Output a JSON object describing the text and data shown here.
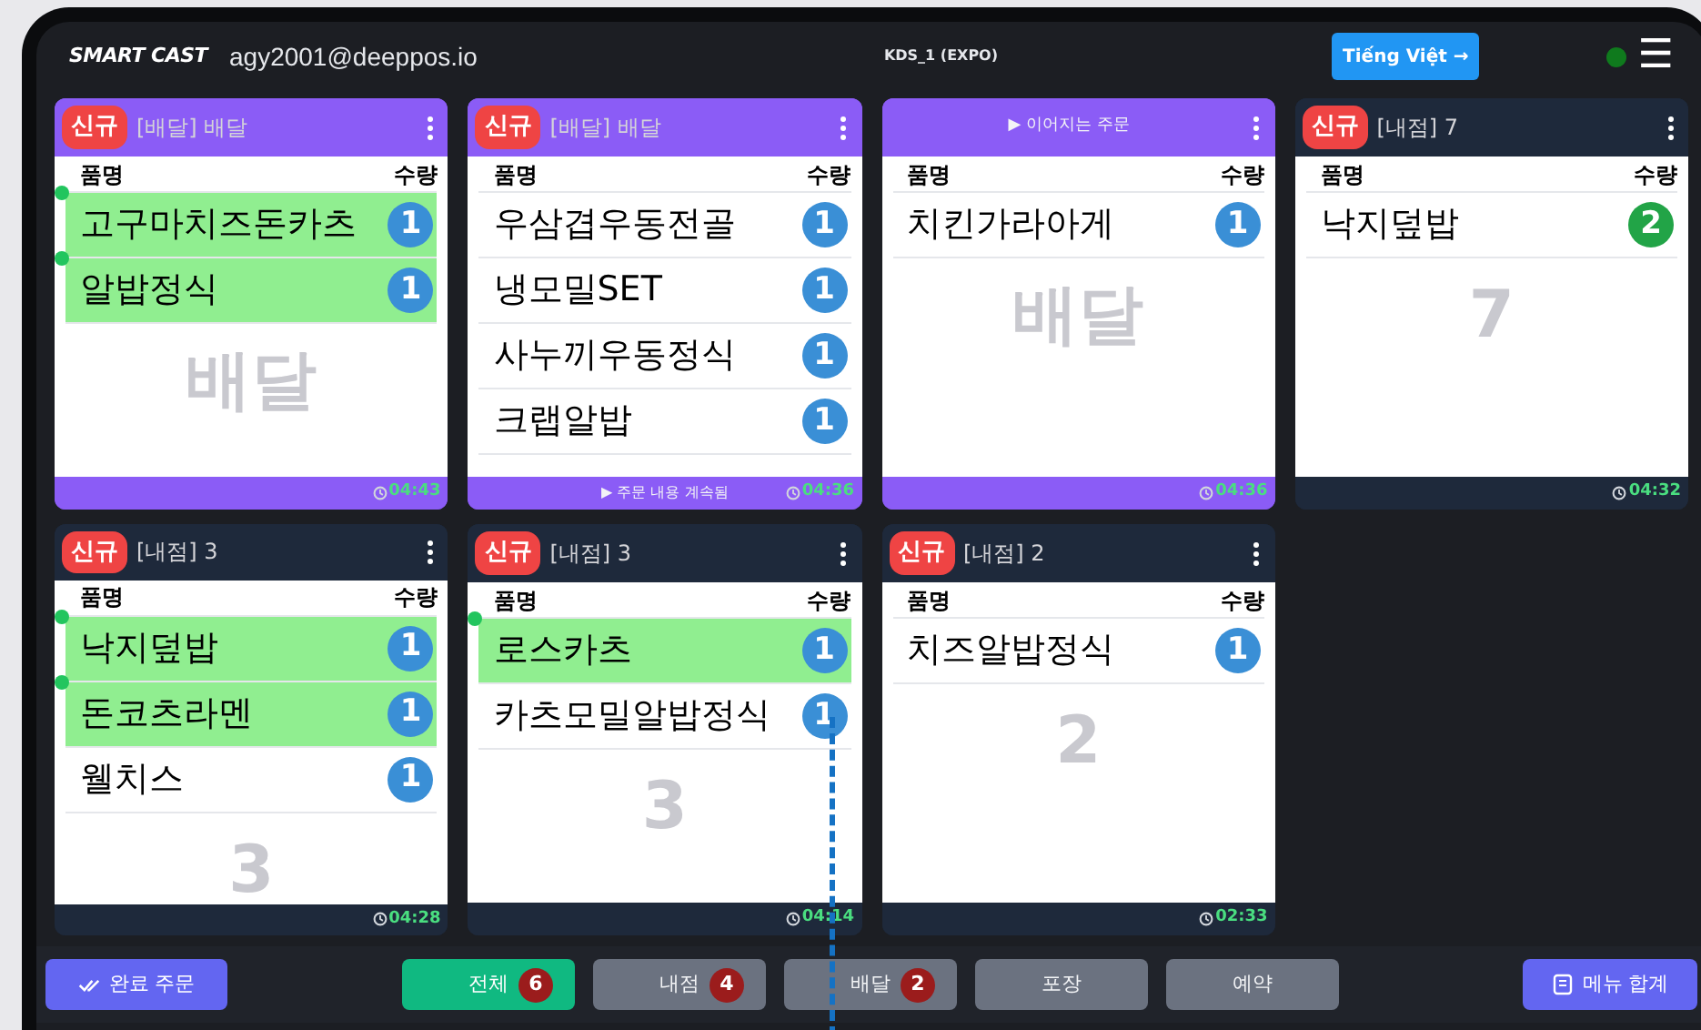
{
  "header": {
    "logo": "SMART CAST",
    "account": "agy2001@deeppos.io",
    "station": "KDS_1 (EXPO)",
    "language_button": "Tiếng Việt →",
    "menu_icon": "☰"
  },
  "orders": [
    {
      "kind": "delivery",
      "badge": "신규",
      "title": "[배달] 배달",
      "name_column": "품명",
      "qty_column": "수량",
      "watermark": "배달",
      "time": "04:43",
      "items": [
        {
          "name": "고구마치즈돈카츠",
          "qty": "1",
          "done": true
        },
        {
          "name": "알밥정식",
          "qty": "1",
          "done": true
        }
      ]
    },
    {
      "kind": "delivery",
      "badge": "신규",
      "title": "[배달] 배달",
      "name_column": "품명",
      "qty_column": "수량",
      "footer_note": "▶ 주문 내용 계속됨",
      "time": "04:36",
      "items": [
        {
          "name": "우삼겹우동전골",
          "qty": "1",
          "done": false
        },
        {
          "name": "냉모밀SET",
          "qty": "1",
          "done": false
        },
        {
          "name": "사누끼우동정식",
          "qty": "1",
          "done": false
        },
        {
          "name": "크랩알밥",
          "qty": "1",
          "done": false
        }
      ]
    },
    {
      "kind": "delivery",
      "header_note": "▶ 이어지는 주문",
      "name_column": "품명",
      "qty_column": "수량",
      "watermark": "배달",
      "time": "04:36",
      "items": [
        {
          "name": "치킨가라아게",
          "qty": "1",
          "done": false
        }
      ]
    },
    {
      "kind": "dine_in",
      "badge": "신규",
      "title": "[내점] 7",
      "name_column": "품명",
      "qty_column": "수량",
      "watermark": "7",
      "time": "04:32",
      "items": [
        {
          "name": "낙지덮밥",
          "qty": "2",
          "done": false
        }
      ]
    },
    {
      "kind": "dine_in",
      "badge": "신규",
      "title": "[내점] 3",
      "name_column": "품명",
      "qty_column": "수량",
      "watermark": "3",
      "time": "04:28",
      "items": [
        {
          "name": "낙지덮밥",
          "qty": "1",
          "done": true
        },
        {
          "name": "돈코츠라멘",
          "qty": "1",
          "done": true
        },
        {
          "name": "웰치스",
          "qty": "1",
          "done": false
        }
      ]
    },
    {
      "kind": "dine_in",
      "badge": "신규",
      "title": "[내점] 3",
      "name_column": "품명",
      "qty_column": "수량",
      "watermark": "3",
      "time": "04:14",
      "items": [
        {
          "name": "로스카츠",
          "qty": "1",
          "done": true
        },
        {
          "name": "카츠모밀알밥정식",
          "qty": "1",
          "done": false
        }
      ]
    },
    {
      "kind": "dine_in",
      "badge": "신규",
      "title": "[내점] 2",
      "name_column": "품명",
      "qty_column": "수량",
      "watermark": "2",
      "time": "02:33",
      "items": [
        {
          "name": "치즈알밥정식",
          "qty": "1",
          "done": false
        }
      ]
    }
  ],
  "bottom_bar": {
    "completed_button": "완료 주문",
    "filters": [
      {
        "label": "전체",
        "count": "6",
        "selected": true
      },
      {
        "label": "내점",
        "count": "4",
        "selected": false
      },
      {
        "label": "배달",
        "count": "2",
        "selected": false
      },
      {
        "label": "포장",
        "selected": false
      },
      {
        "label": "예약",
        "selected": false
      }
    ],
    "summary_button": "메뉴 합계"
  }
}
